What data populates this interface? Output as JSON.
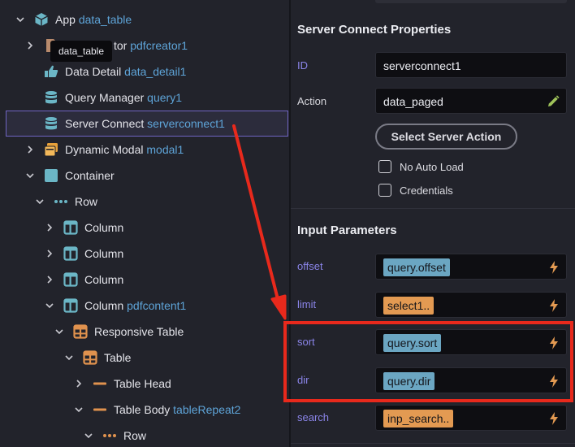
{
  "tooltip": "data_table",
  "tree": [
    {
      "name": "App",
      "id": "data_table",
      "icon": "cube-icon",
      "chevron": "down"
    },
    {
      "name": "",
      "id": "pdfcreator1",
      "icon": "file-icon",
      "chevron": "right",
      "partial": "tor"
    },
    {
      "name": "Data Detail",
      "id": "data_detail1",
      "icon": "hand-pointer-icon",
      "chevron": ""
    },
    {
      "name": "Query Manager",
      "id": "query1",
      "icon": "database-icon",
      "chevron": ""
    },
    {
      "name": "Server Connect",
      "id": "serverconnect1",
      "icon": "database-icon",
      "chevron": "",
      "selected": true
    },
    {
      "name": "Dynamic Modal",
      "id": "modal1",
      "icon": "modal-icon",
      "chevron": "right"
    },
    {
      "name": "Container",
      "id": "",
      "icon": "square-icon",
      "chevron": "down"
    },
    {
      "name": "Row",
      "id": "",
      "icon": "dots-icon",
      "chevron": "down"
    },
    {
      "name": "Column",
      "id": "",
      "icon": "column-icon",
      "chevron": "right"
    },
    {
      "name": "Column",
      "id": "",
      "icon": "column-icon",
      "chevron": "right"
    },
    {
      "name": "Column",
      "id": "",
      "icon": "column-icon",
      "chevron": "right"
    },
    {
      "name": "Column",
      "id": "pdfcontent1",
      "icon": "column-icon",
      "chevron": "down"
    },
    {
      "name": "Responsive Table",
      "id": "",
      "icon": "table-icon",
      "chevron": "down"
    },
    {
      "name": "Table",
      "id": "",
      "icon": "table-icon",
      "chevron": "down"
    },
    {
      "name": "Table Head",
      "id": "",
      "icon": "dash-icon",
      "chevron": "right"
    },
    {
      "name": "Table Body",
      "id": "tableRepeat2",
      "icon": "dash-icon",
      "chevron": "down"
    },
    {
      "name": "Row",
      "id": "",
      "icon": "dots-icon",
      "chevron": "down"
    }
  ],
  "props": {
    "title": "Server Connect Properties",
    "id_label": "ID",
    "id_value": "serverconnect1",
    "action_label": "Action",
    "action_value": "data_paged",
    "select_button": "Select Server Action",
    "no_auto_load": "No Auto Load",
    "credentials": "Credentials",
    "input_title": "Input Parameters",
    "params": [
      {
        "label": "offset",
        "value": "query.offset",
        "color": "blue"
      },
      {
        "label": "limit",
        "value": "select1..",
        "color": "orange"
      },
      {
        "label": "sort",
        "value": "query.sort",
        "color": "blue"
      },
      {
        "label": "dir",
        "value": "query.dir",
        "color": "blue"
      },
      {
        "label": "search",
        "value": "inp_search..",
        "color": "orange"
      }
    ]
  },
  "colors": {
    "accent": "#8a84e8",
    "selection": "#6f64c2",
    "chip_blue": "#6ba6c2",
    "chip_orange": "#e39a52",
    "annotation": "#e8291c"
  }
}
